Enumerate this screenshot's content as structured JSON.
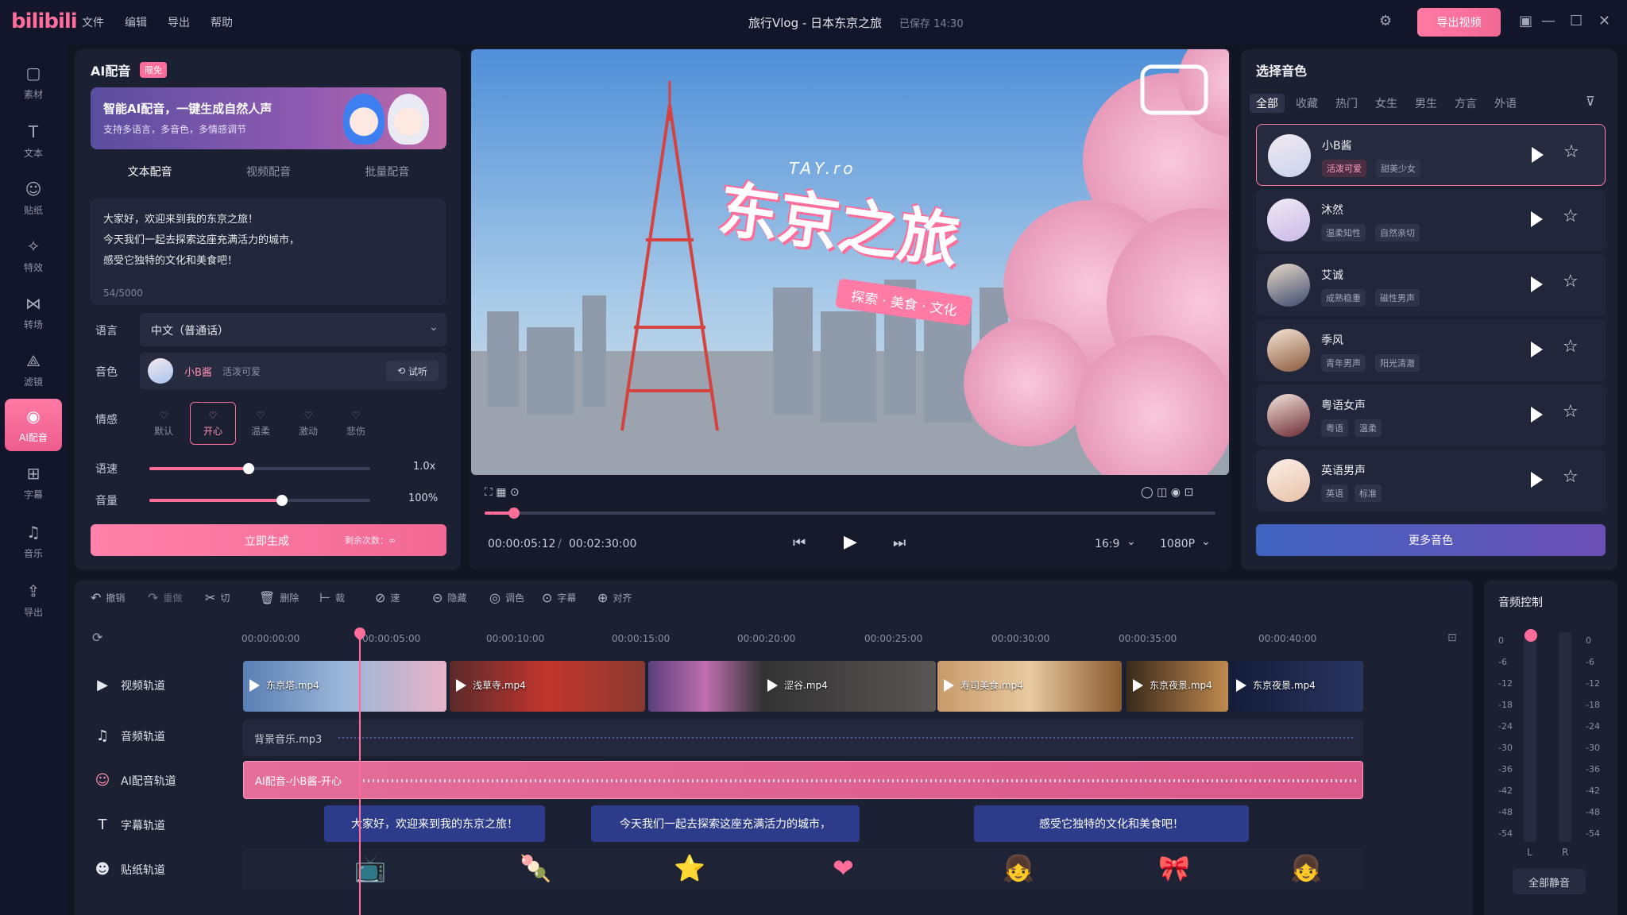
{
  "app": {
    "logo": "bilibili",
    "title": "旅行Vlog - 日本东京之旅",
    "saved": "已保存 14:30",
    "export": "导出视频",
    "menu": [
      "文件",
      "编辑",
      "导出",
      "帮助"
    ]
  },
  "sidebar": [
    {
      "label": "素材",
      "icon": "media-icon"
    },
    {
      "label": "文本",
      "icon": "text-icon"
    },
    {
      "label": "贴纸",
      "icon": "sticker-icon"
    },
    {
      "label": "特效",
      "icon": "effects-icon"
    },
    {
      "label": "转场",
      "icon": "transition-icon"
    },
    {
      "label": "滤镜",
      "icon": "filter-icon"
    },
    {
      "label": "AI配音",
      "icon": "ai-voice-icon"
    },
    {
      "label": "字幕",
      "icon": "subtitle-icon"
    },
    {
      "label": "音乐",
      "icon": "music-icon"
    },
    {
      "label": "导出",
      "icon": "export-icon"
    }
  ],
  "ai_panel": {
    "title": "AI配音",
    "badge": "限免",
    "banner_title": "智能AI配音，一键生成自然人声",
    "banner_sub": "支持多语言，多音色，多情感调节",
    "tabs": [
      "文本配音",
      "视频配音",
      "批量配音"
    ],
    "text_lines": [
      "大家好，欢迎来到我的东京之旅！",
      "今天我们一起去探索这座充满活力的城市，",
      "感受它独特的文化和美食吧！"
    ],
    "char_count": "54/5000",
    "lang_label": "语言",
    "lang_value": "中文（普通话）",
    "voice_label": "音色",
    "voice_name": "小B酱",
    "voice_desc": "活泼可爱",
    "preview": "试听",
    "emotion_label": "情感",
    "emotions": [
      "默认",
      "开心",
      "温柔",
      "激动",
      "悲伤"
    ],
    "speed_label": "语速",
    "speed_value": "1.0x",
    "speed_level": 0.45,
    "volume_label": "音量",
    "volume_value": "100%",
    "volume_level": 0.6,
    "generate": "立即生成",
    "remaining": "剩余次数：∞"
  },
  "video": {
    "title_text": "东京之旅",
    "subtitle_text": "探索 · 美食 · 文化",
    "script_text": "TAY.ro",
    "current": "00:00:05:12",
    "total": "00:02:30:00",
    "ratio": "16:9",
    "resolution": "1080P",
    "progress": 0.04
  },
  "voices_panel": {
    "title": "选择音色",
    "filters": [
      "全部",
      "收藏",
      "热门",
      "女生",
      "男生",
      "方言",
      "外语"
    ],
    "voices": [
      {
        "name": "小B酱",
        "tags": [
          "活泼可爱",
          "甜美少女"
        ]
      },
      {
        "name": "沐然",
        "tags": [
          "温柔知性",
          "自然亲切"
        ]
      },
      {
        "name": "艾诚",
        "tags": [
          "成熟稳重",
          "磁性男声"
        ]
      },
      {
        "name": "季风",
        "tags": [
          "青年男声",
          "阳光清澈"
        ]
      },
      {
        "name": "粤语女声",
        "tags": [
          "粤语",
          "温柔"
        ]
      },
      {
        "name": "英语男声",
        "tags": [
          "英语",
          "标准"
        ]
      }
    ],
    "more": "更多音色"
  },
  "timeline": {
    "tools": [
      "撤销",
      "重做",
      "切",
      "删除",
      "裁",
      "速",
      "隐藏",
      "调色",
      "字幕",
      "对齐"
    ],
    "ticks": [
      "00:00:00:00",
      "00:00:05:00",
      "00:00:10:00",
      "00:00:15:00",
      "00:00:20:00",
      "00:00:25:00",
      "00:00:30:00",
      "00:00:35:00",
      "00:00:40:00"
    ],
    "tracks": [
      "视频轨道",
      "音频轨道",
      "AI配音轨道",
      "字幕轨道",
      "贴纸轨道"
    ],
    "clips": [
      "东京塔.mp4",
      "浅草寺.mp4",
      "涩谷.mp4",
      "寿司美食.mp4",
      "东京夜景.mp4",
      "东京夜景.mp4"
    ],
    "audio_clip": "背景音乐.mp3",
    "ai_clip": "AI配音-小B酱-开心",
    "subs": [
      "大家好，欢迎来到我的东京之旅！",
      "今天我们一起去探索这座充满活力的城市，",
      "感受它独特的文化和美食吧！"
    ],
    "stickers": [
      "📺",
      "🍡",
      "⭐",
      "❤",
      "👧",
      "🎀",
      "👧"
    ]
  },
  "audio_ctrl": {
    "title": "音频控制",
    "db": [
      "0",
      "-6",
      "-12",
      "-18",
      "-24",
      "-30",
      "-36",
      "-42",
      "-48",
      "-54"
    ],
    "left": "L",
    "right": "R",
    "mute": "全部静音"
  }
}
